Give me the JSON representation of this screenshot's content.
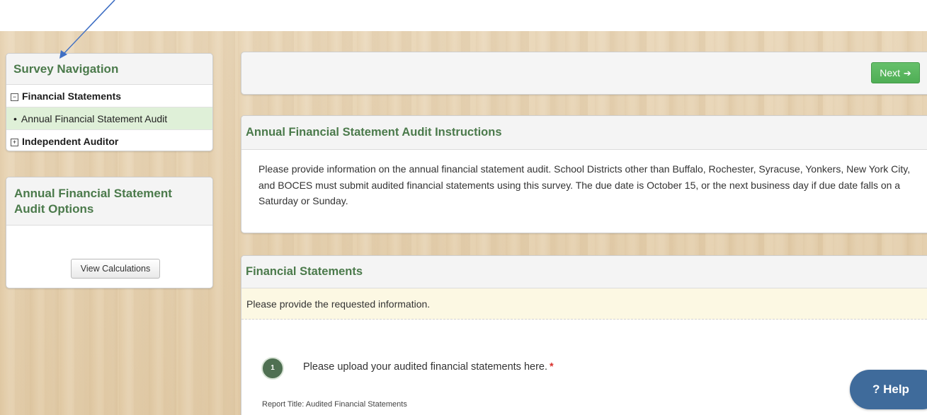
{
  "colors": {
    "heading_green": "#4b7a4b",
    "next_green": "#55b35a",
    "active_row": "#dff0d8",
    "notice_bg": "#fcf8e3",
    "help_blue": "#3f6b9b",
    "required_red": "#d9332e",
    "annotation_arrow": "#3f6fc4"
  },
  "survey_nav": {
    "title": "Survey Navigation",
    "sections": [
      {
        "label": "Financial Statements",
        "toggle_icon": "collapse-icon",
        "toggle_symbol": "−",
        "items": [
          {
            "label": "Annual Financial Statement Audit",
            "bullet": "•",
            "active": true
          }
        ]
      },
      {
        "label": "Independent Auditor",
        "toggle_icon": "expand-icon",
        "toggle_symbol": "+",
        "items": []
      }
    ]
  },
  "options": {
    "title": "Annual Financial Statement Audit Options",
    "view_calculations_label": "View Calculations"
  },
  "topbar": {
    "next_label": "Next",
    "next_icon": "arrow-right-icon",
    "next_icon_symbol": "➔"
  },
  "instructions": {
    "title": "Annual Financial Statement Audit Instructions",
    "text": "Please provide information on the annual financial statement audit. School Districts other than Buffalo, Rochester, Syracuse, Yonkers, New York City, and BOCES must submit audited financial statements using this survey.  The due date is October 15, or the next business day if due date falls on a Saturday or Sunday."
  },
  "financial_statements": {
    "title": "Financial Statements",
    "notice": "Please provide the requested information.",
    "question": {
      "number": "1",
      "text": "Please upload your audited financial statements here.",
      "required_mark": "*"
    },
    "report_title": "Report Title: Audited Financial Statements"
  },
  "help": {
    "label": "? Help"
  }
}
